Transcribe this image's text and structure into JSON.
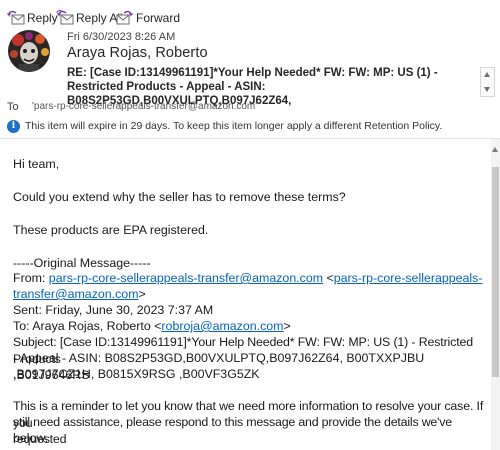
{
  "toolbar": {
    "reply_label": "Reply",
    "reply_all_label": "Reply All",
    "forward_label": "Forward"
  },
  "header": {
    "date": "Fri 6/30/2023 8:26 AM",
    "sender": "Araya Rojas, Roberto",
    "subject": "RE: [Case ID:13149961191]*Your Help Needed* FW: FW: MP: US (1) - Restricted Products - Appeal - ASIN:   B08S2P53GD,B00VXULPTQ,B097J62Z64,",
    "to_label": "To",
    "to_value": "'pars-rp-core-sellerappeals-transfer@amazon.com'",
    "retention_notice": "This item will expire in 29 days. To keep this item longer apply a different Retention Policy."
  },
  "body": {
    "greeting": "Hi team,",
    "question": "Could you extend why the seller has to remove these terms?",
    "epa_note": "These products are EPA registered.",
    "original_divider": "-----Original Message-----",
    "from_label": "From: ",
    "from_email": "pars-rp-core-sellerappeals-transfer@amazon.com",
    "from_bracket_open": " <",
    "from_email_link_1": "pars-rp-core-sellerappeals-",
    "from_email_link_2": "transfer@amazon.com",
    "from_bracket_close": ">",
    "sent": "Sent: Friday, June 30, 2023 7:37 AM",
    "to_prefix": "To: Araya Rojas, Roberto <",
    "to_email": "robroja@amazon.com",
    "to_suffix": ">",
    "subject_line_1": "Subject: [Case ID:13149961191]*Your Help Needed* FW: FW: MP: US (1) - Restricted Products",
    "subject_line_2": "- Appeal - ASIN: B08S2P53GD,B00VXULPTQ,B097J62Z64, B00TXXPJBU ,B01J9646RS",
    "subject_line_3": ",B097J7CZ1H, B0815X9RSG ,B00VF3G5ZK",
    "reminder_1": "This is a reminder to let you know that we need more information to resolve your case. If you",
    "reminder_2": "still need assistance, please respond to this message and provide the details we've requested",
    "reminder_3": "below."
  },
  "colors": {
    "link": "#0563c1",
    "info_icon": "#1e6fc8"
  }
}
